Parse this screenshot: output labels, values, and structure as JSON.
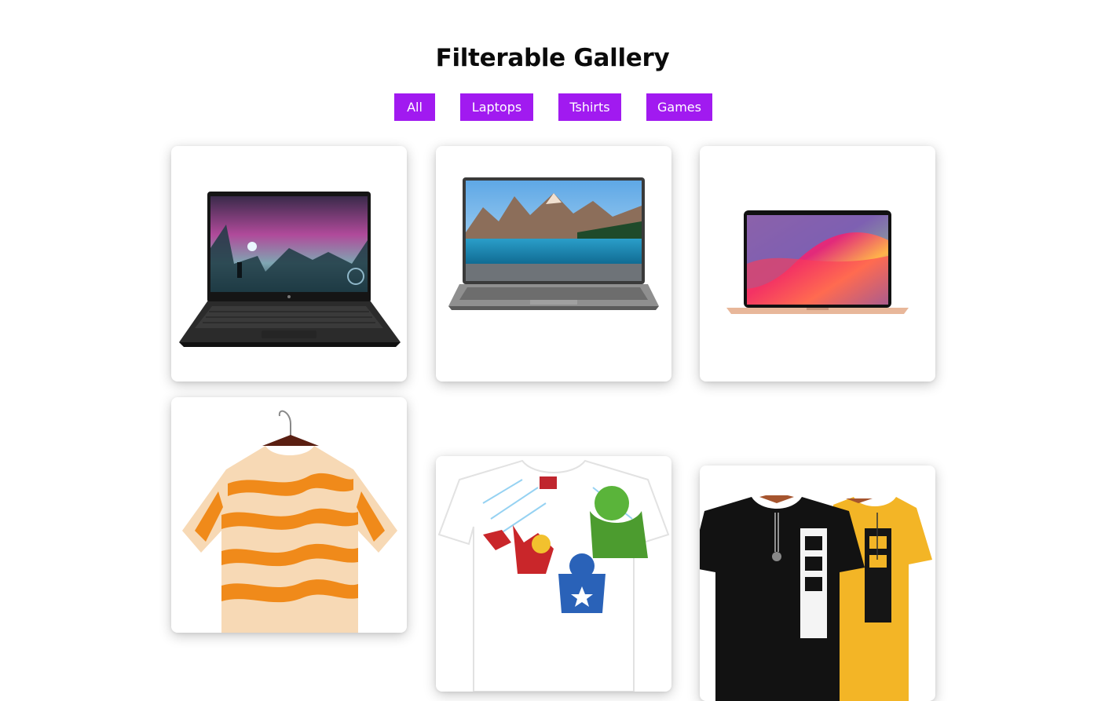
{
  "page": {
    "title": "Filterable Gallery"
  },
  "filters": [
    {
      "label": "All"
    },
    {
      "label": "Laptops"
    },
    {
      "label": "Tshirts"
    },
    {
      "label": "Games"
    }
  ],
  "theme": {
    "accent": "#a11af0",
    "button_text": "#ffffff",
    "title_color": "#0b0b0b"
  },
  "gallery": {
    "items": [
      {
        "category": "laptops",
        "icon": "gaming-laptop-image"
      },
      {
        "category": "laptops",
        "icon": "laptop-lake-image"
      },
      {
        "category": "laptops",
        "icon": "macbook-image"
      },
      {
        "category": "tshirts",
        "icon": "zebra-print-tshirt-image"
      },
      {
        "category": "tshirts",
        "icon": "avengers-tshirt-image"
      },
      {
        "category": "tshirts",
        "icon": "black-yellow-tshirts-image"
      }
    ]
  }
}
